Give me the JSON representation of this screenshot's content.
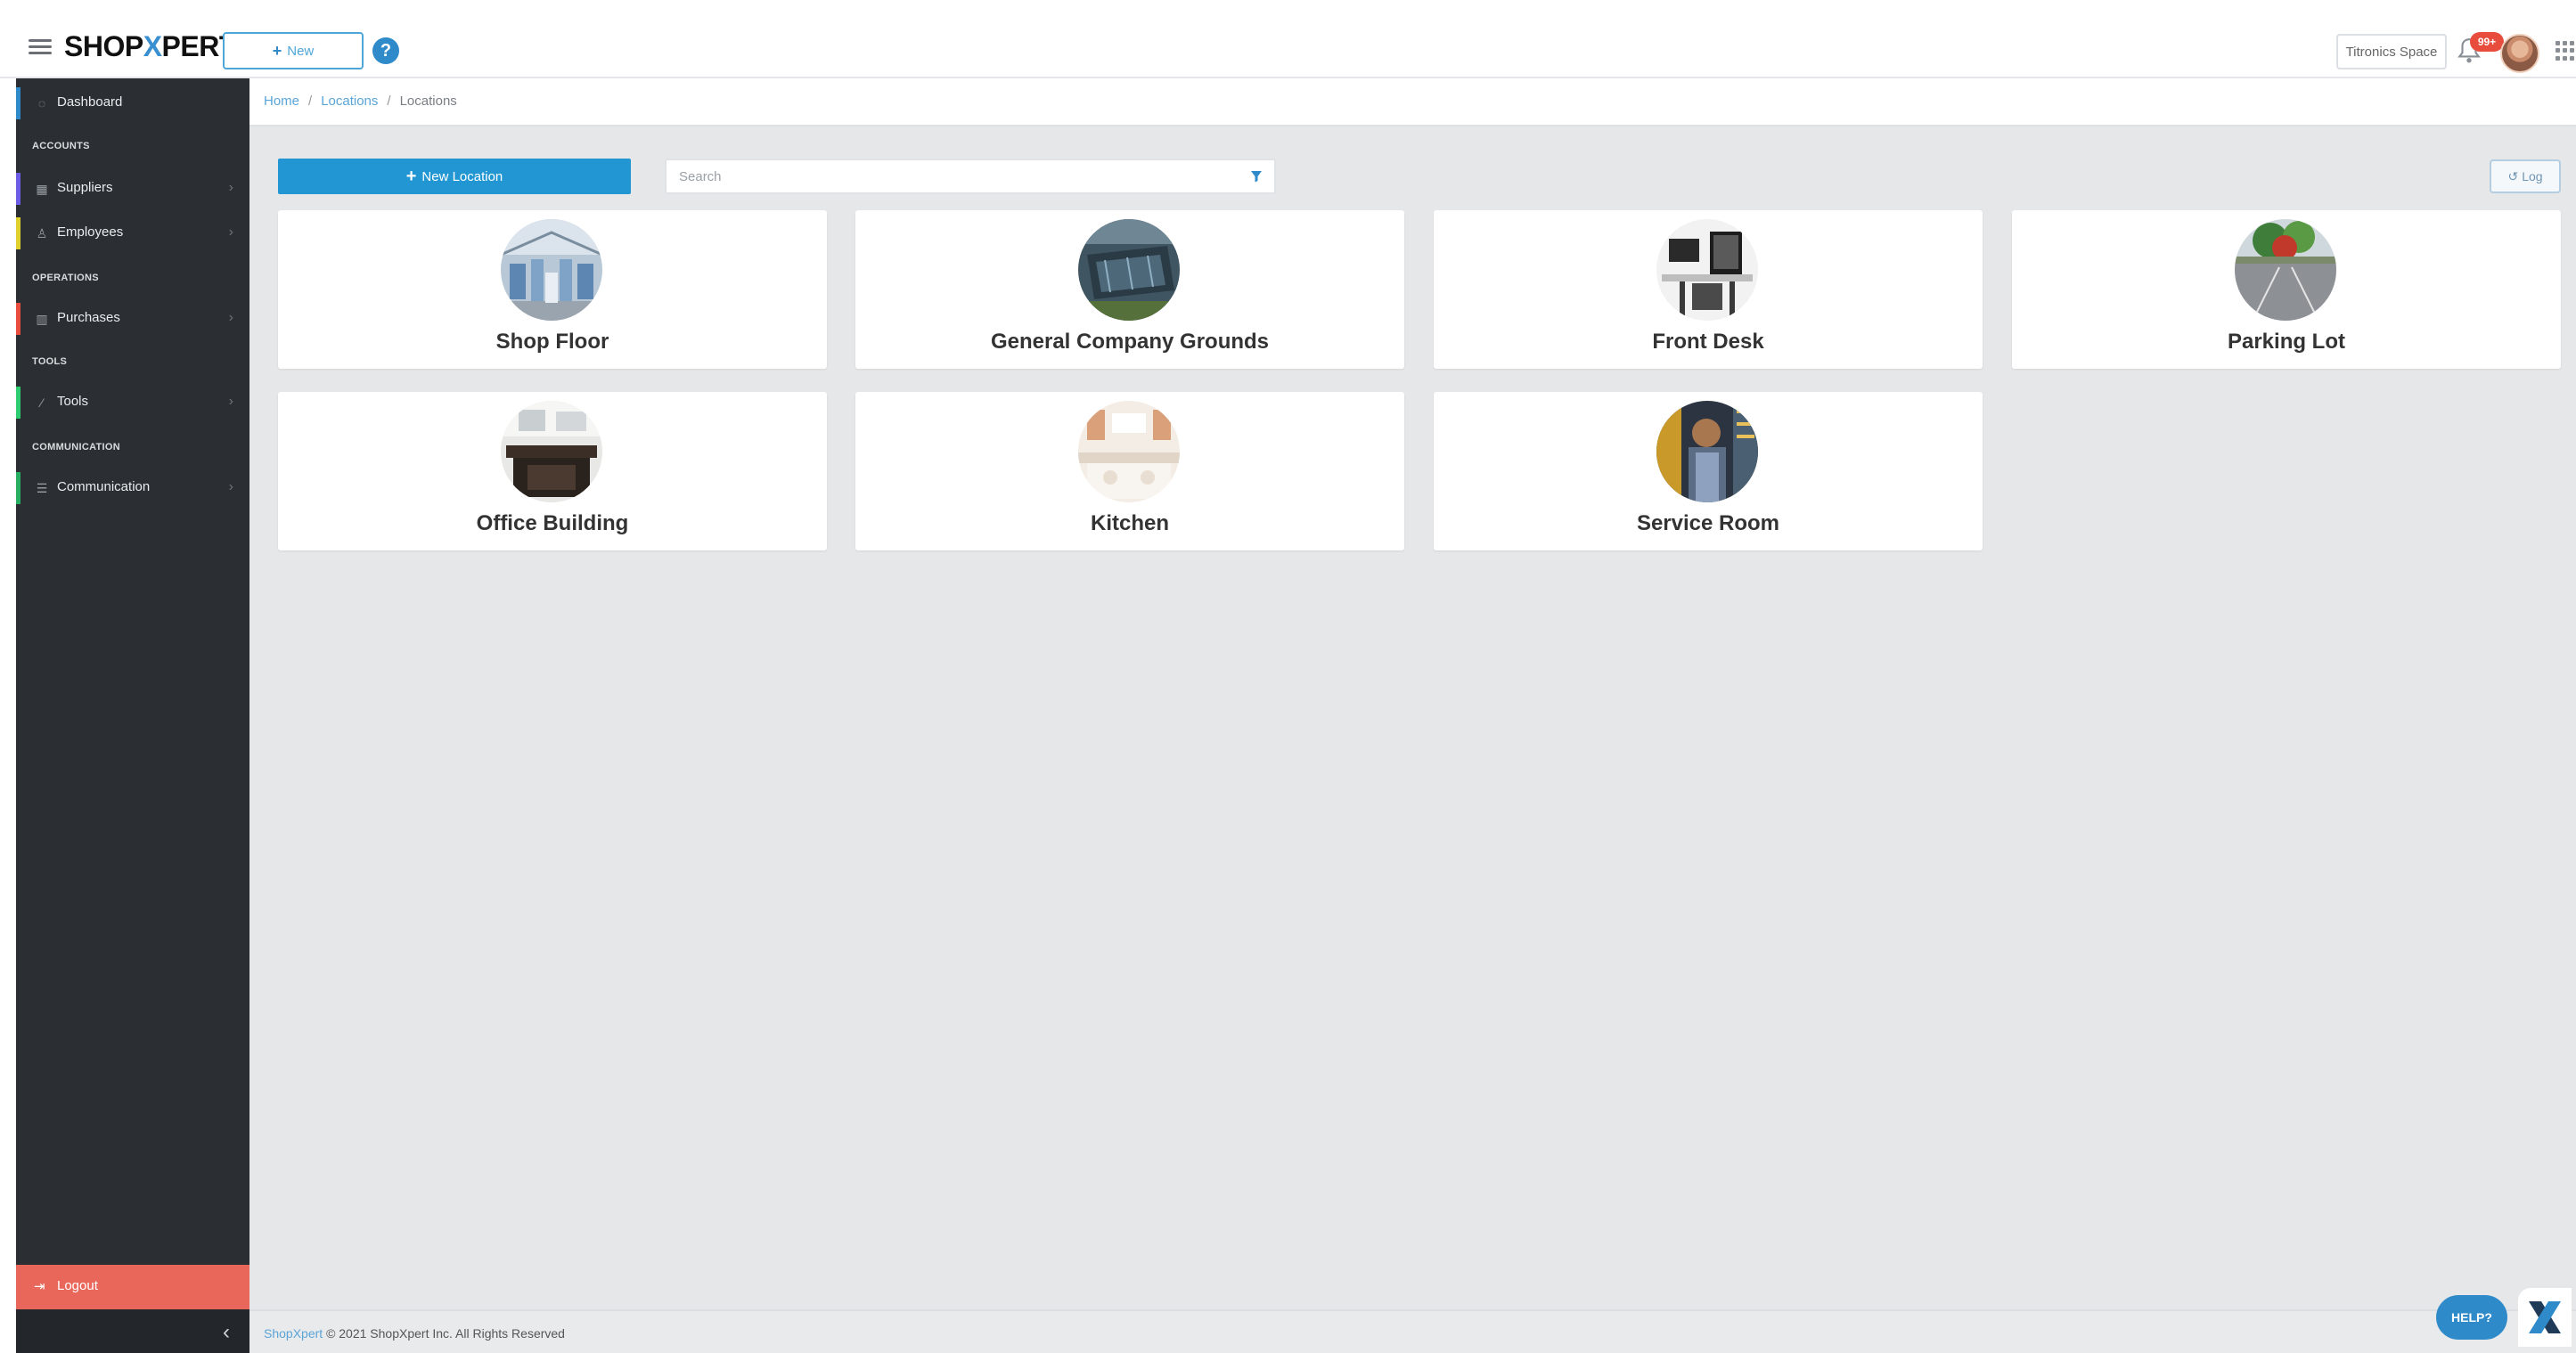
{
  "header": {
    "logo_left": "SHOP",
    "logo_x": "X",
    "logo_right": "PERT",
    "new_button": "New",
    "help_icon": "?",
    "space_button": "Titronics Space",
    "notification_count": "99+",
    "icons": [
      "hamburger-icon",
      "plus-icon",
      "help-icon",
      "bell-icon",
      "avatar",
      "apps-grid-icon"
    ]
  },
  "sidebar": {
    "dashboard": {
      "label": "Dashboard",
      "icon": "dashboard-icon",
      "accent": "#2f8ac9"
    },
    "sections": {
      "accounts": "ACCOUNTS",
      "operations": "OPERATIONS",
      "tools": "TOOLS",
      "communication": "COMMUNICATION"
    },
    "items": [
      {
        "label": "Suppliers",
        "icon": "suppliers-icon",
        "accent": "#6c5ce7"
      },
      {
        "label": "Employees",
        "icon": "employees-icon",
        "accent": "#e0d02c"
      },
      {
        "label": "Purchases",
        "icon": "purchases-icon",
        "accent": "#e74c3c"
      },
      {
        "label": "Tools",
        "icon": "tools-icon",
        "accent": "#2ecc71"
      },
      {
        "label": "Communication",
        "icon": "communication-icon",
        "accent": "#27ae60"
      }
    ],
    "logout": "Logout",
    "collapse": "‹"
  },
  "breadcrumb": {
    "home": "Home",
    "locations_link": "Locations",
    "current": "Locations",
    "separator": "/"
  },
  "toolbar": {
    "new_location": "New Location",
    "search_placeholder": "Search",
    "log_button": "Log"
  },
  "locations": [
    {
      "name": "Shop Floor",
      "image": "warehouse"
    },
    {
      "name": "General Company Grounds",
      "image": "aerial-grounds"
    },
    {
      "name": "Front Desk",
      "image": "desk"
    },
    {
      "name": "Parking Lot",
      "image": "parking"
    },
    {
      "name": "Office Building",
      "image": "office"
    },
    {
      "name": "Kitchen",
      "image": "kitchen"
    },
    {
      "name": "Service Room",
      "image": "server-room"
    }
  ],
  "footer": {
    "brand_link": "ShopXpert",
    "copyright": "© 2021 ShopXpert Inc. All Rights Reserved"
  },
  "help_bubble": "HELP?",
  "colors": {
    "primary": "#2196d3",
    "sidebar_bg": "#2b2f33",
    "logout_bg": "#e8665a",
    "main_bg": "#e6e7e9"
  }
}
